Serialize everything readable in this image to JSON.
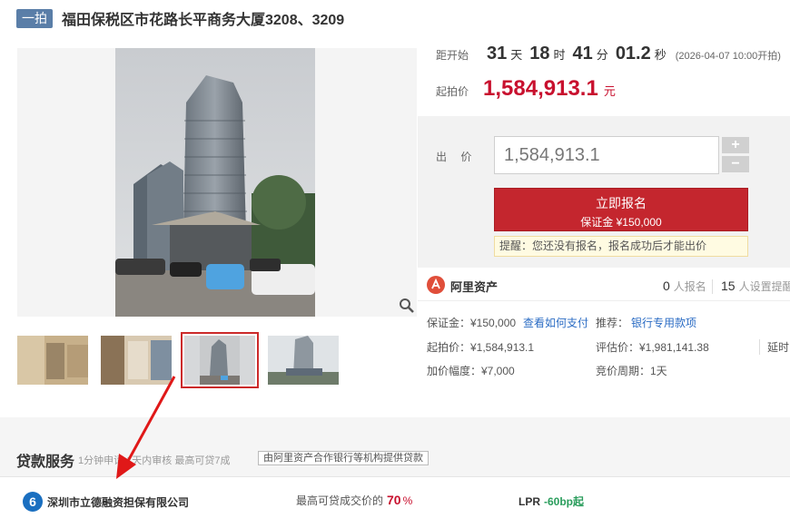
{
  "title": {
    "tag": "一拍",
    "text": "福田保税区市花路长平商务大厦3208、3209"
  },
  "countdown": {
    "label": "距开始",
    "days": "31",
    "days_unit": "天",
    "hours": "18",
    "hours_unit": "时",
    "minutes": "41",
    "minutes_unit": "分",
    "seconds": "01.2",
    "seconds_unit": "秒",
    "start_note": "(2026-04-07 10:00开拍)"
  },
  "start_price": {
    "label": "起拍价",
    "value": "1,584,913.1",
    "unit": "元"
  },
  "bid": {
    "label": "出 价",
    "input_value": "1,584,913.1",
    "plus": "+",
    "minus": "−",
    "signup_main": "立即报名",
    "signup_sub": "保证金 ¥150,000",
    "notice": "提醒：您还没有报名，报名成功后才能出价"
  },
  "platform": {
    "name": "阿里资产",
    "signed_up_count": "0",
    "signed_up_label": "人报名",
    "reminder_count": "15",
    "reminder_label": "人设置提醒"
  },
  "details": {
    "deposit": "保证金：¥150,000",
    "how_to_pay": "查看如何支付",
    "recommend_label": "推荐：",
    "recommend_link": "银行专用款项",
    "start_price": "起拍价：¥1,584,913.1",
    "appraisal": "评估价：¥1,981,141.38",
    "delay": "延时",
    "increment": "加价幅度：¥7,000",
    "cycle": "竞价周期：1天"
  },
  "loan": {
    "title": "贷款服务",
    "subtitle": "1分钟申请 1天内审核 最高可贷7成",
    "badge": "由阿里资产合作银行等机构提供贷款",
    "company": "深圳市立德融资担保有限公司",
    "ratio_label": "最高可贷成交价的",
    "ratio_value": "70",
    "ratio_unit": "%",
    "lpr_label": "LPR",
    "lpr_value": "-60bp起"
  },
  "colors": {
    "accent_red": "#c8102e",
    "button_red": "#c4262e",
    "link_blue": "#2b6cc4",
    "tag_blue": "#5a7ea8"
  }
}
